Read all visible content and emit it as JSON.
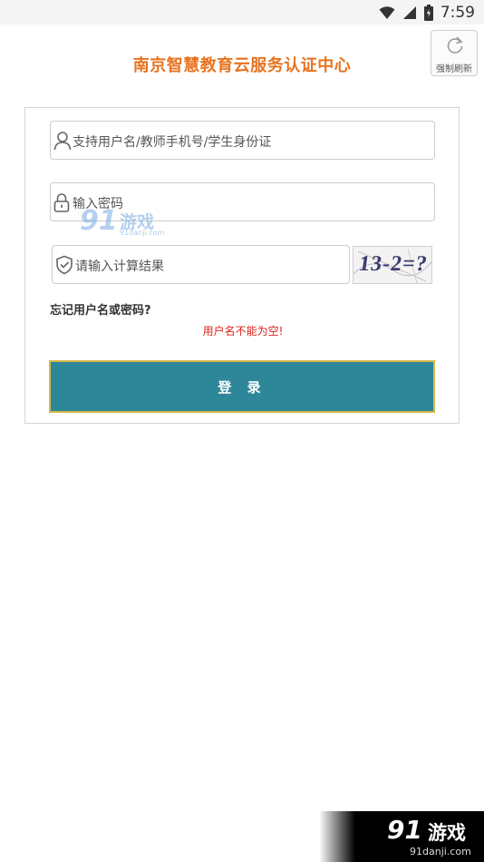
{
  "status_bar": {
    "time": "7:59"
  },
  "header": {
    "title": "南京智慧教育云服务认证中心",
    "refresh_label": "强制刷新"
  },
  "form": {
    "username_placeholder": "支持用户名/教师手机号/学生身份证",
    "password_placeholder": "输入密码",
    "captcha_placeholder": "请输入计算结果",
    "captcha_text": "13-2=?",
    "forgot_link": "忘记用户名或密码?",
    "error_message": "用户名不能为空!",
    "login_label": "登 录"
  },
  "watermark": {
    "center_91": "91",
    "center_name": "游戏",
    "center_url": "91danji.com",
    "corner_91": "91",
    "corner_name": "游戏",
    "corner_url": "91danji.com"
  },
  "icons": [
    "wifi-icon",
    "signal-icon",
    "battery-icon",
    "refresh-icon",
    "user-icon",
    "lock-icon",
    "shield-check-icon"
  ],
  "colors": {
    "title": "#e8731e",
    "login_button": "#2e8699",
    "error": "#d9231d"
  }
}
